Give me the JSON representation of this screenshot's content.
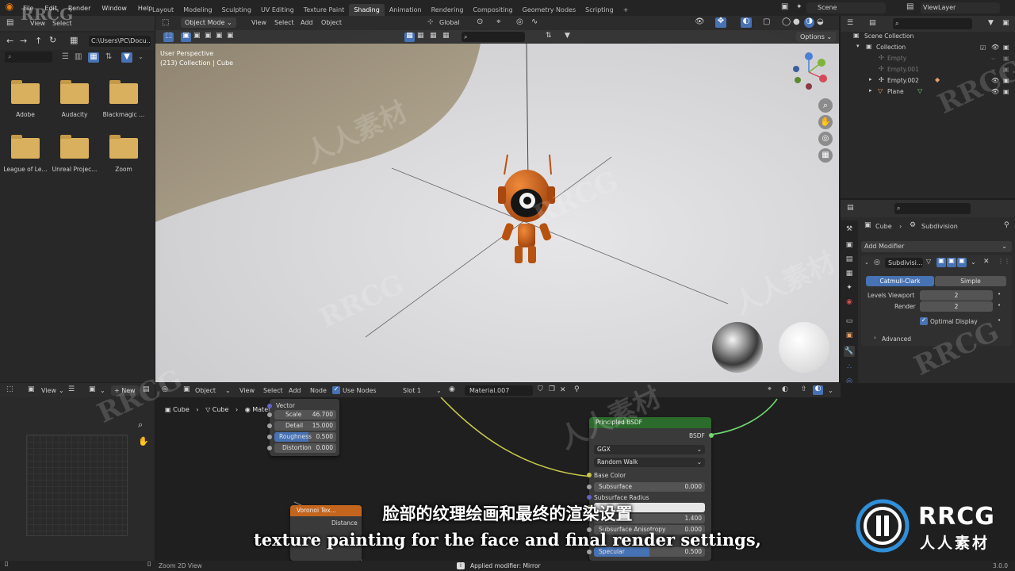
{
  "menu": [
    "File",
    "Edit",
    "Render",
    "Window",
    "Help"
  ],
  "workspace_tabs": [
    "Layout",
    "Modeling",
    "Sculpting",
    "UV Editing",
    "Texture Paint",
    "Shading",
    "Animation",
    "Rendering",
    "Compositing",
    "Geometry Nodes",
    "Scripting"
  ],
  "active_workspace": "Shading",
  "scene": "Scene",
  "view_layer": "ViewLayer",
  "file_browser": {
    "header_items": [
      "View",
      "Select"
    ],
    "path": "C:\\Users\\PC\\Docu...",
    "folders": [
      "Adobe",
      "Audacity",
      "Blackmagic ...",
      "League of Le...",
      "Unreal Projec...",
      "Zoom"
    ]
  },
  "viewport": {
    "mode": "Object Mode",
    "menus": [
      "View",
      "Select",
      "Add",
      "Object"
    ],
    "transform": "Global",
    "options": "Options",
    "perspective": "User Perspective",
    "collection_info": "(213) Collection | Cube"
  },
  "outliner": {
    "root": "Scene Collection",
    "items": [
      "Collection",
      "Empty",
      "Empty.001",
      "Empty.002",
      "Plane"
    ]
  },
  "properties": {
    "object": "Cube",
    "modifier_context": "Subdivision",
    "add_modifier": "Add Modifier",
    "modifier_name": "Subdivisi...",
    "mode_catmull": "Catmull-Clark",
    "mode_simple": "Simple",
    "levels_viewport_label": "Levels Viewport",
    "levels_viewport": "2",
    "render_label": "Render",
    "render": "2",
    "optimal_display": "Optimal Display",
    "advanced": "Advanced"
  },
  "node_editor": {
    "type": "Object",
    "menus": [
      "View",
      "Select",
      "Add",
      "Node"
    ],
    "use_nodes": "Use Nodes",
    "slot": "Slot 1",
    "material": "Material.007",
    "breadcrumb": [
      "Cube",
      "Cube",
      "Material.007"
    ],
    "noise_node": {
      "vector": "Vector",
      "fields": [
        {
          "label": "Scale",
          "value": "46.700"
        },
        {
          "label": "Detail",
          "value": "15.000"
        },
        {
          "label": "Roughness",
          "value": "0.500"
        },
        {
          "label": "Distortion",
          "value": "0.000"
        }
      ]
    },
    "voronoi_title": "Voronoi Tex...",
    "voronoi_row": "Distance",
    "bsdf_node": {
      "title": "Principled BSDF",
      "output": "BSDF",
      "distribution": "GGX",
      "subsurface_method": "Random Walk",
      "base_color": "Base Color",
      "subsurface": {
        "label": "Subsurface",
        "value": "0.000"
      },
      "subsurface_radius": "Subsurface Radius",
      "value_1400": "1.400",
      "subsurface_anisotropy": {
        "label": "Subsurface Anisotropy",
        "value": "0.000"
      },
      "specular": {
        "label": "Specular",
        "value": "0.500"
      }
    }
  },
  "image_editor": {
    "menus": [
      "View"
    ],
    "new_label": "New"
  },
  "status": {
    "left": "Zoom 2D View",
    "center": "Applied modifier: Mirror",
    "version": "3.0.0"
  },
  "subtitle": {
    "cn": "脸部的纹理绘画和最终的渲染设置",
    "en": "texture painting for the face and final render settings,"
  },
  "watermark": {
    "latin": "RRCG",
    "cn": "人人素材"
  },
  "colors": {
    "accent_blue": "#4772b3",
    "node_green": "#2b6b2b",
    "node_orange": "#c4651e",
    "robot_orange": "#d2691e"
  }
}
